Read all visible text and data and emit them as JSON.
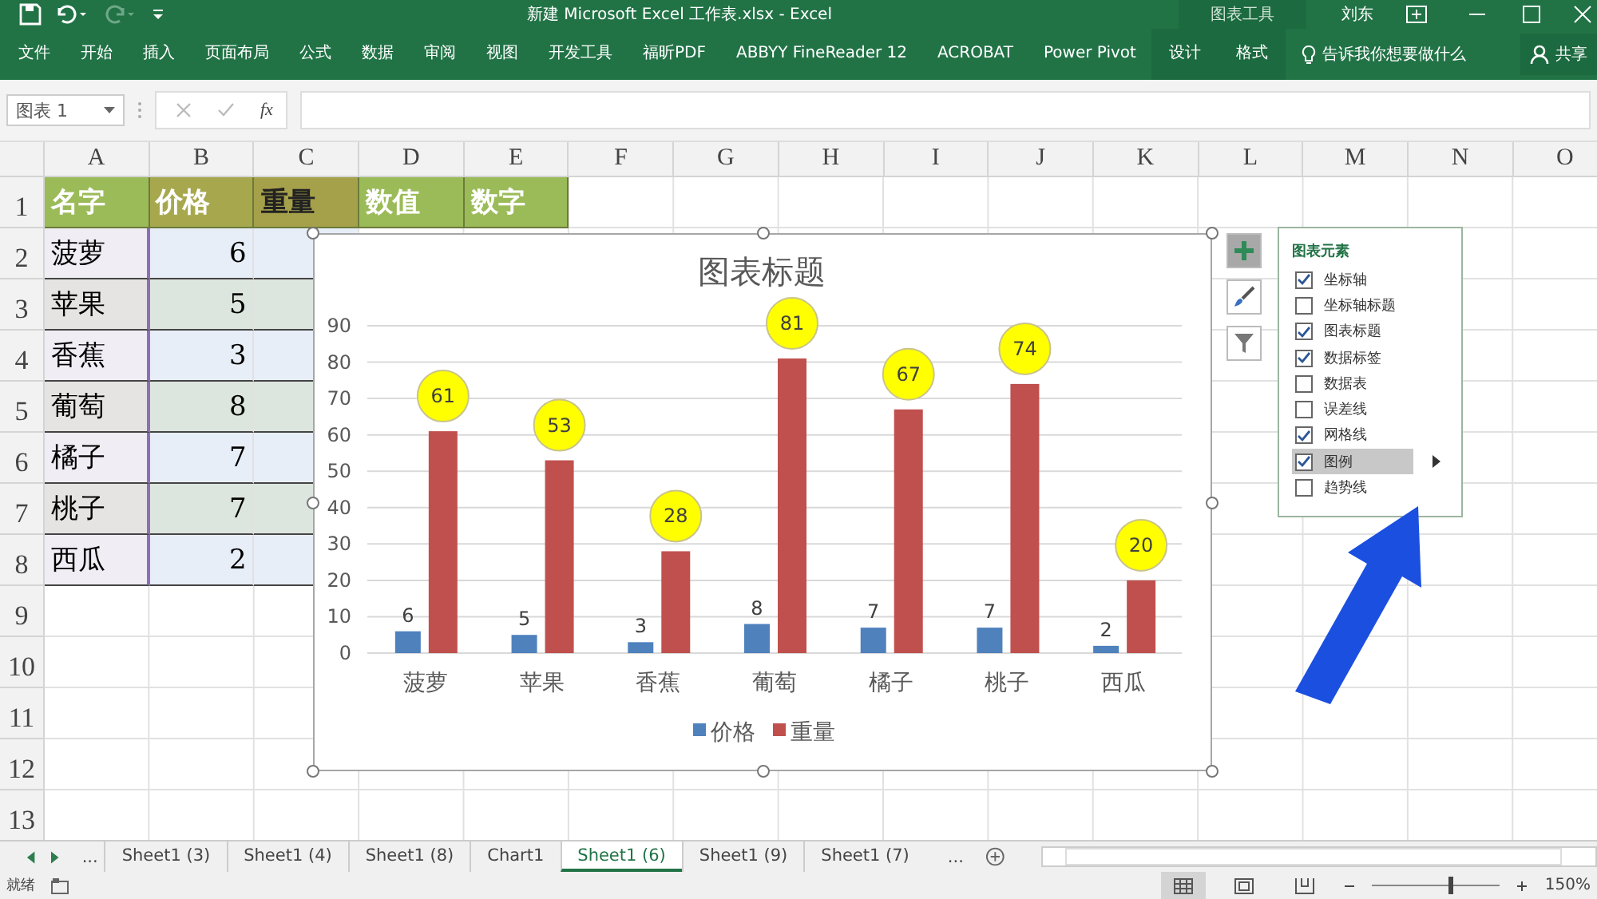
{
  "title_bar": {
    "title": "新建 Microsoft Excel 工作表.xlsx  -  Excel",
    "context_label": "图表工具",
    "user": "刘东"
  },
  "ribbon": {
    "tabs": [
      {
        "label": "文件",
        "kind": "normal"
      },
      {
        "label": "开始",
        "kind": "normal"
      },
      {
        "label": "插入",
        "kind": "normal"
      },
      {
        "label": "页面布局",
        "kind": "normal"
      },
      {
        "label": "公式",
        "kind": "normal"
      },
      {
        "label": "数据",
        "kind": "normal"
      },
      {
        "label": "审阅",
        "kind": "normal"
      },
      {
        "label": "视图",
        "kind": "normal"
      },
      {
        "label": "开发工具",
        "kind": "normal"
      },
      {
        "label": "福昕PDF",
        "kind": "normal"
      },
      {
        "label": "ABBYY FineReader 12",
        "kind": "normal"
      },
      {
        "label": "ACROBAT",
        "kind": "normal"
      },
      {
        "label": "Power Pivot",
        "kind": "normal"
      },
      {
        "label": "设计",
        "kind": "context"
      },
      {
        "label": "格式",
        "kind": "context"
      }
    ],
    "tell_me": "告诉我你想要做什么",
    "share": "共享"
  },
  "formula_bar": {
    "name_box": "图表 1",
    "function_label": "fx"
  },
  "sheet": {
    "columns": [
      "A",
      "B",
      "C",
      "D",
      "E",
      "F",
      "G",
      "H",
      "I",
      "J",
      "K",
      "L",
      "M",
      "N",
      "O"
    ],
    "rows": [
      {
        "number": "1",
        "cells": [
          {
            "text": "名字",
            "kind": "header"
          },
          {
            "text": "价格",
            "kind": "header_selected"
          },
          {
            "text": "重量",
            "kind": "header_active"
          },
          {
            "text": "数值",
            "kind": "header"
          },
          {
            "text": "数字",
            "kind": "header"
          }
        ]
      },
      {
        "number": "2",
        "cells": [
          {
            "text": "菠萝",
            "kind": "label"
          },
          {
            "text": "6",
            "kind": "number"
          },
          {
            "kind": "fill"
          }
        ]
      },
      {
        "number": "3",
        "cells": [
          {
            "text": "苹果",
            "kind": "label"
          },
          {
            "text": "5",
            "kind": "number"
          },
          {
            "kind": "fill"
          }
        ]
      },
      {
        "number": "4",
        "cells": [
          {
            "text": "香蕉",
            "kind": "label"
          },
          {
            "text": "3",
            "kind": "number"
          },
          {
            "kind": "fill"
          }
        ]
      },
      {
        "number": "5",
        "cells": [
          {
            "text": "葡萄",
            "kind": "label"
          },
          {
            "text": "8",
            "kind": "number"
          },
          {
            "kind": "fill"
          }
        ]
      },
      {
        "number": "6",
        "cells": [
          {
            "text": "橘子",
            "kind": "label"
          },
          {
            "text": "7",
            "kind": "number"
          },
          {
            "kind": "fill"
          }
        ]
      },
      {
        "number": "7",
        "cells": [
          {
            "text": "桃子",
            "kind": "label"
          },
          {
            "text": "7",
            "kind": "number"
          },
          {
            "kind": "fill"
          }
        ]
      },
      {
        "number": "8",
        "cells": [
          {
            "text": "西瓜",
            "kind": "label"
          },
          {
            "text": "2",
            "kind": "number"
          },
          {
            "kind": "fill"
          }
        ]
      },
      {
        "number": "9"
      },
      {
        "number": "10"
      },
      {
        "number": "11"
      },
      {
        "number": "12"
      },
      {
        "number": "13"
      }
    ]
  },
  "chart": {
    "chart_data": {
      "type": "bar",
      "title": "图表标题",
      "categories": [
        "菠萝",
        "苹果",
        "香蕉",
        "葡萄",
        "橘子",
        "桃子",
        "西瓜"
      ],
      "series": [
        {
          "name": "价格",
          "color": "#4f81bd",
          "values": [
            6,
            5,
            3,
            8,
            7,
            7,
            2
          ]
        },
        {
          "name": "重量",
          "color": "#c0504d",
          "values": [
            61,
            53,
            28,
            81,
            67,
            74,
            20
          ]
        }
      ],
      "ylim": [
        0,
        90
      ],
      "yticks": [
        0,
        10,
        20,
        30,
        40,
        50,
        60,
        70,
        80,
        90
      ],
      "data_labels": true,
      "grid": true,
      "legend": true
    }
  },
  "chart_elements": {
    "title": "图表元素",
    "items": [
      {
        "label": "坐标轴",
        "checked": true,
        "selected": false
      },
      {
        "label": "坐标轴标题",
        "checked": false,
        "selected": false
      },
      {
        "label": "图表标题",
        "checked": true,
        "selected": false
      },
      {
        "label": "数据标签",
        "checked": true,
        "selected": false
      },
      {
        "label": "数据表",
        "checked": false,
        "selected": false
      },
      {
        "label": "误差线",
        "checked": false,
        "selected": false
      },
      {
        "label": "网格线",
        "checked": true,
        "selected": false
      },
      {
        "label": "图例",
        "checked": true,
        "selected": true
      },
      {
        "label": "趋势线",
        "checked": false,
        "selected": false
      }
    ]
  },
  "sheet_tabs": {
    "more_left": "...",
    "tabs": [
      {
        "label": "Sheet1 (3)",
        "selected": false
      },
      {
        "label": "Sheet1 (4)",
        "selected": false
      },
      {
        "label": "Sheet1 (8)",
        "selected": false
      },
      {
        "label": "Chart1",
        "selected": false
      },
      {
        "label": "Sheet1 (6)",
        "selected": true
      },
      {
        "label": "Sheet1 (9)",
        "selected": false
      },
      {
        "label": "Sheet1 (7)",
        "selected": false
      }
    ],
    "more_right": "..."
  },
  "status_bar": {
    "text": "就绪",
    "zoom_slider": {
      "level": 0.6
    },
    "zoom": "150%"
  }
}
